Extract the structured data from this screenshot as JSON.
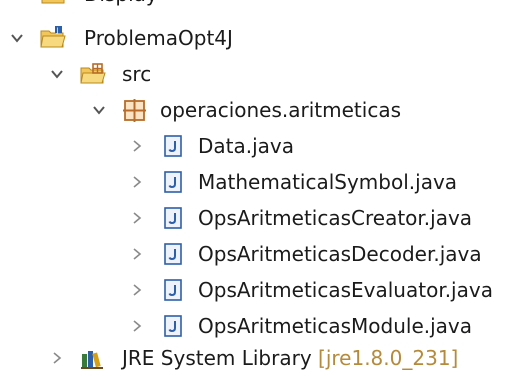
{
  "tree": {
    "partial_top_item": "Display",
    "project": {
      "label": "ProblemaOpt4J",
      "expanded": true
    },
    "src_folder": {
      "label": "src",
      "expanded": true
    },
    "package": {
      "label": "operaciones.aritmeticas",
      "expanded": true
    },
    "files": [
      {
        "label": "Data.java"
      },
      {
        "label": "MathematicalSymbol.java"
      },
      {
        "label": "OpsAritmeticasCreator.java"
      },
      {
        "label": "OpsAritmeticasDecoder.java"
      },
      {
        "label": "OpsAritmeticasEvaluator.java"
      },
      {
        "label": "OpsAritmeticasModule.java"
      }
    ],
    "library": {
      "label": "JRE System Library",
      "decoration": "[jre1.8.0_231]",
      "expanded": false
    }
  },
  "colors": {
    "text": "#1b1b1b",
    "chevron": "#555555",
    "decoration": "#b58a3a",
    "folder_fill": "#f2c65a",
    "package_brown": "#b86b28",
    "java_file_blue": "#2d5fa8"
  }
}
